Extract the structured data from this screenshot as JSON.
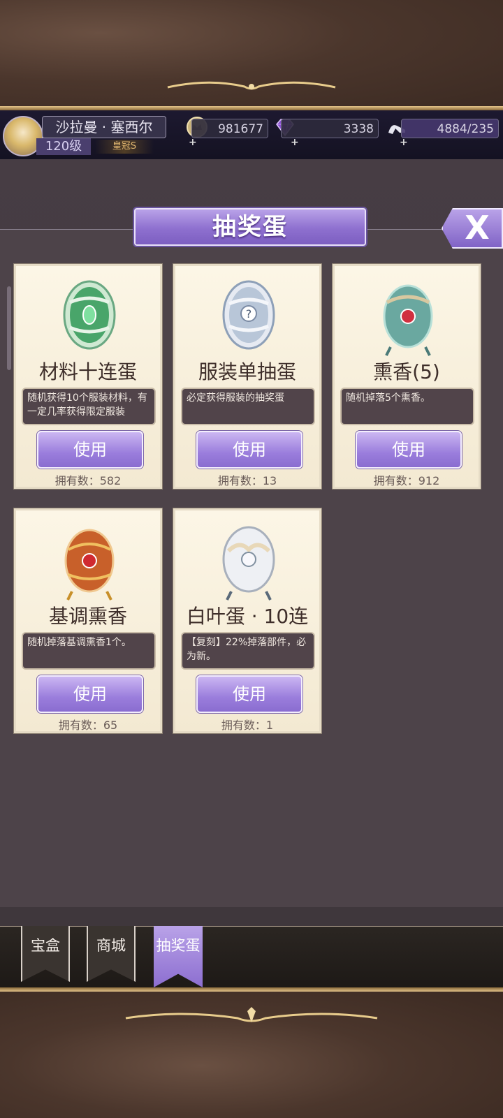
{
  "player": {
    "name": "沙拉曼 · 塞西尔",
    "level": "120级",
    "title": "皇冠S"
  },
  "resources": {
    "gold": "981677",
    "diamond": "3338",
    "stamina": "4884/235"
  },
  "popup": {
    "title": "抽奖蛋",
    "close_label": "X"
  },
  "items": [
    {
      "name": "材料十连蛋",
      "desc": "随机获得10个服装材料，有一定几率获得限定服装",
      "use": "使用",
      "owned": "拥有数：582",
      "egg": "green-egg-icon"
    },
    {
      "name": "服装单抽蛋",
      "desc": "必定获得服装的抽奖蛋",
      "use": "使用",
      "owned": "拥有数：13",
      "egg": "silver-egg-icon"
    },
    {
      "name": "熏香(5)",
      "desc": "随机掉落5个熏香。",
      "use": "使用",
      "owned": "拥有数：912",
      "egg": "teal-incense-egg-icon"
    },
    {
      "name": "基调熏香",
      "desc": "随机掉落基调熏香1个。",
      "use": "使用",
      "owned": "拥有数：65",
      "egg": "orange-incense-egg-icon"
    },
    {
      "name": "白叶蛋 · 10连",
      "desc": "【复刻】22%掉落部件，必为新。",
      "use": "使用",
      "owned": "拥有数：1",
      "egg": "white-leaf-egg-icon"
    }
  ],
  "tabs": [
    {
      "label": "宝盒",
      "active": false
    },
    {
      "label": "商城",
      "active": false
    },
    {
      "label": "抽奖蛋",
      "active": true
    }
  ],
  "colors": {
    "accent": "#9a7ddc",
    "panel": "#4d4349",
    "card": "#fcf6e6"
  }
}
